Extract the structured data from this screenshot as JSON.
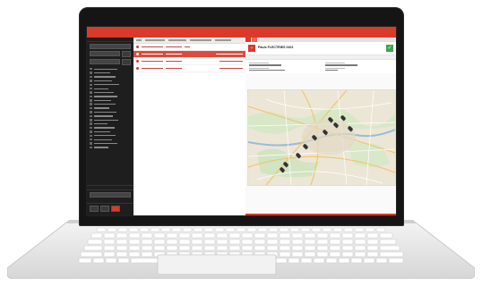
{
  "topbar": {
    "nav": [
      "",
      "",
      "",
      "",
      "",
      "",
      ""
    ],
    "user_line1": "",
    "user_line2": ""
  },
  "detail": {
    "tabs": [
      "",
      ""
    ],
    "subtitle": "",
    "title": "Pauls FLECTRIES 0401"
  },
  "icons": {
    "check": "check-icon",
    "logo": "company-logo-icon",
    "pin": "map-pin-icon"
  },
  "colors": {
    "accent": "#d93a2a",
    "ok": "#3fa34d",
    "sidebar": "#1e1e1e"
  }
}
